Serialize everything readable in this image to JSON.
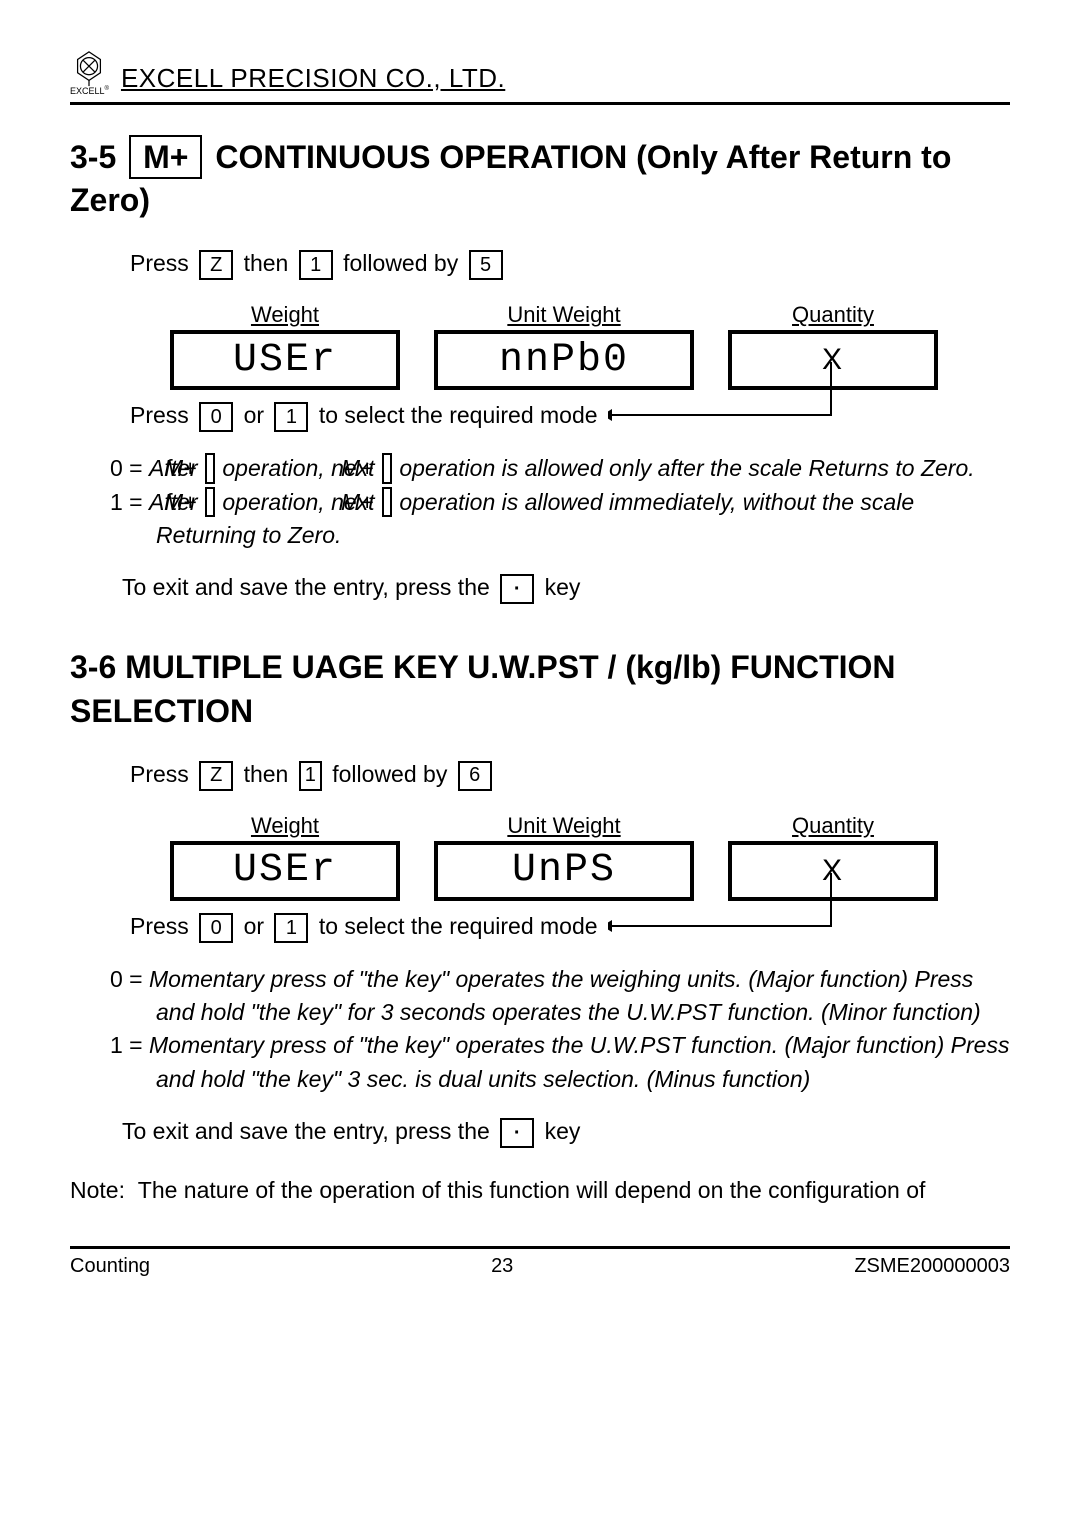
{
  "header": {
    "logo_sub": "EXCELL",
    "company": "EXCELL PRECISION CO., LTD."
  },
  "section35": {
    "title_prefix": "3-5",
    "title_key": "M+",
    "title_rest": "CONTINUOUS OPERATION (Only After Return to Zero)",
    "press": "Press",
    "then": "then",
    "followed_by": "followed by",
    "key_z": "Z",
    "key_1": "1",
    "key_5": "5",
    "labels": {
      "weight": "Weight",
      "unit_weight": "Unit Weight",
      "quantity": "Quantity"
    },
    "disp_weight": "USEr",
    "disp_uw": "nnPb0",
    "disp_q": "X",
    "press2": "Press",
    "key_0": "0",
    "or": "or",
    "key_1b": "1",
    "select_text": "to select the required mode",
    "def0_pre": "0 = ",
    "def0_a": "After ",
    "def0_key": "M+",
    "def0_b": " operation, next ",
    "def0_c": " operation is allowed only after the scale Returns to Zero.",
    "def1_pre": "1 = ",
    "def1_a": "After ",
    "def1_key": "M+",
    "def1_b": " operation, next ",
    "def1_c": " operation is allowed immediately, without the scale Returning to Zero.",
    "exit_a": "To exit and save the entry, press the",
    "exit_key": "·",
    "exit_b": "key"
  },
  "section36": {
    "title": "3-6 MULTIPLE UAGE KEY    U.W.PST / (kg/lb) FUNCTION SELECTION",
    "press": "Press",
    "then": "then",
    "followed_by": "followed by",
    "key_z": "Z",
    "key_1": "1",
    "key_6": "6",
    "labels": {
      "weight": "Weight",
      "unit_weight": "Unit Weight",
      "quantity": "Quantity"
    },
    "disp_weight": "USEr",
    "disp_uw": "UnPS",
    "disp_q": "X",
    "press2": "Press",
    "key_0": "0",
    "or": "or",
    "key_1b": "1",
    "select_text": "to select the required mode",
    "def0": "0 = Momentary press of \"the key\" operates the weighing units. (Major function) Press and hold \"the key\" for 3 seconds operates the U.W.PST function. (Minor function)",
    "def1": "1 = Momentary press of \"the key\" operates the U.W.PST function. (Major function) Press and hold \"the key\" 3 sec. is dual units selection. (Minus function)",
    "exit_a": "To exit and save the entry, press the",
    "exit_key": "·",
    "exit_b": "key"
  },
  "note": {
    "label": "Note:",
    "text": "The nature of the operation of this function will depend on the configuration of"
  },
  "footer": {
    "left": "Counting",
    "center": "23",
    "right": "ZSME200000003"
  }
}
